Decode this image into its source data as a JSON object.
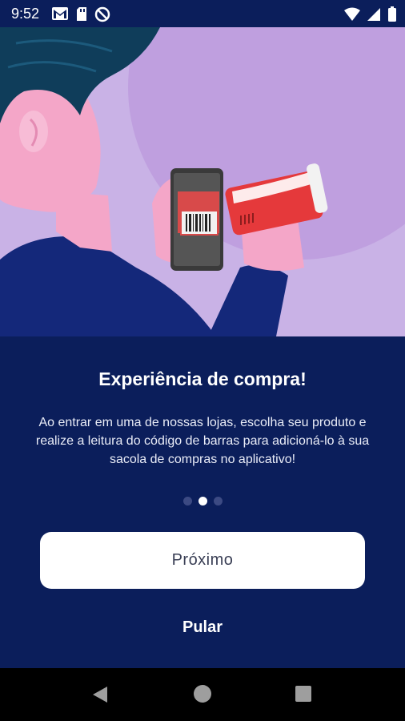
{
  "status_bar": {
    "time": "9:52",
    "left_icons": [
      "gmail-icon",
      "sd-card-icon",
      "no-sim-icon"
    ],
    "right_icons": [
      "wifi-icon",
      "signal-icon",
      "battery-icon"
    ]
  },
  "hero": {
    "illustration": "person-scanning-barcode-with-phone",
    "colors": {
      "background": "#c9b2e6",
      "circle": "#bf9fdf",
      "hair": "#0f3d5a",
      "skin": "#f4a6c8",
      "shirt": "#14287a",
      "phone": "#3a3a3a",
      "product": "#e5393b"
    }
  },
  "onboarding": {
    "title": "Experiência de compra!",
    "description": "Ao entrar em uma de nossas lojas, escolha seu produto e realize a leitura do código de barras para adicioná-lo à sua sacola de compras no aplicativo!",
    "page_count": 3,
    "active_page": 2
  },
  "buttons": {
    "next_label": "Próximo",
    "skip_label": "Pular"
  },
  "nav_bar": {
    "icons": [
      "back-icon",
      "home-icon",
      "recents-icon"
    ]
  },
  "theme": {
    "primary": "#0b1e5b",
    "button_bg": "#ffffff",
    "dot_inactive": "#3c4a83",
    "dot_active": "#ffffff"
  }
}
